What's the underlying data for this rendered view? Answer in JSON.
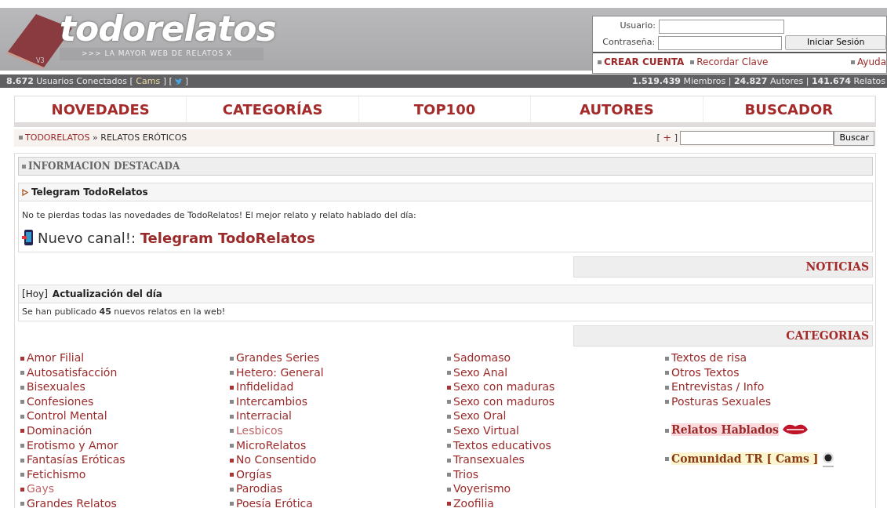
{
  "header": {
    "logo": "todorelatos",
    "version": "V3",
    "tagline": ">>> LA MAYOR WEB DE RELATOS X"
  },
  "login": {
    "user_label": "Usuario:",
    "password_label": "Contraseña:",
    "submit": "Iniciar Sesión",
    "links": [
      {
        "label": "CREAR CUENTA",
        "bold": true
      },
      {
        "label": "Recordar Clave",
        "bold": false
      },
      {
        "label": "Ayuda",
        "bold": false
      }
    ]
  },
  "status_bar": {
    "online_count": "8.672",
    "online_label": "Usuarios Conectados",
    "cams_before": "[",
    "cams": "Cams",
    "cams_after": "] [",
    "twitter_after": "]",
    "separator_1": "|",
    "separator_2": "|",
    "members": "1.519.439",
    "members_label": "Miembros",
    "authors": "24.827",
    "authors_label": "Autores",
    "stories": "141.674",
    "stories_label": "Relatos"
  },
  "nav": [
    "NOVEDADES",
    "CATEGORÍAS",
    "TOP100",
    "AUTORES",
    "BUSCADOR"
  ],
  "breadcrumb": {
    "home": "TODORELATOS",
    "separator": "»",
    "current": "RELATOS ERÓTICOS",
    "plus_open": "[",
    "plus": "+",
    "plus_close": "]",
    "search_button": "Buscar"
  },
  "featured": {
    "heading": "INFORMACION DESTACADA",
    "item_title": "Telegram TodoRelatos",
    "text": "No te pierdas todas las novedades de TodoRelatos! El mejor relato y relato hablado del día:",
    "channel_prefix": "Nuevo canal!:",
    "channel_link": "Telegram TodoRelatos"
  },
  "news": {
    "heading": "NOTICIAS",
    "tag": "[Hoy]",
    "title": "Actualización del día",
    "text": "Se han publicado **45** nuevos relatos en la web!"
  },
  "categories": {
    "heading": "CATEGORIAS",
    "columns": [
      [
        {
          "label": "Amor Filial",
          "marked": true,
          "dimmed": false
        },
        {
          "label": "Autosatisfacción",
          "marked": false,
          "dimmed": false
        },
        {
          "label": "Bisexuales",
          "marked": false,
          "dimmed": false
        },
        {
          "label": "Confesiones",
          "marked": false,
          "dimmed": false
        },
        {
          "label": "Control Mental",
          "marked": false,
          "dimmed": false
        },
        {
          "label": "Dominación",
          "marked": true,
          "dimmed": false
        },
        {
          "label": "Erotismo y Amor",
          "marked": false,
          "dimmed": false
        },
        {
          "label": "Fantasías Eróticas",
          "marked": false,
          "dimmed": false
        },
        {
          "label": "Fetichismo",
          "marked": false,
          "dimmed": false
        },
        {
          "label": "Gays",
          "marked": true,
          "dimmed": true
        },
        {
          "label": "Grandes Relatos",
          "marked": false,
          "dimmed": false
        }
      ],
      [
        {
          "label": "Grandes Series",
          "marked": false,
          "dimmed": false
        },
        {
          "label": "Hetero: General",
          "marked": false,
          "dimmed": false
        },
        {
          "label": "Infidelidad",
          "marked": true,
          "dimmed": false
        },
        {
          "label": "Intercambios",
          "marked": false,
          "dimmed": false
        },
        {
          "label": "Interracial",
          "marked": false,
          "dimmed": false
        },
        {
          "label": "Lesbicos",
          "marked": false,
          "dimmed": true
        },
        {
          "label": "MicroRelatos",
          "marked": false,
          "dimmed": false
        },
        {
          "label": "No Consentido",
          "marked": true,
          "dimmed": false
        },
        {
          "label": "Orgías",
          "marked": true,
          "dimmed": false
        },
        {
          "label": "Parodias",
          "marked": false,
          "dimmed": false
        },
        {
          "label": "Poesía Erótica",
          "marked": false,
          "dimmed": false
        }
      ],
      [
        {
          "label": "Sadomaso",
          "marked": false,
          "dimmed": false
        },
        {
          "label": "Sexo Anal",
          "marked": false,
          "dimmed": false
        },
        {
          "label": "Sexo con maduras",
          "marked": true,
          "dimmed": false
        },
        {
          "label": "Sexo con maduros",
          "marked": false,
          "dimmed": false
        },
        {
          "label": "Sexo Oral",
          "marked": false,
          "dimmed": false
        },
        {
          "label": "Sexo Virtual",
          "marked": false,
          "dimmed": false
        },
        {
          "label": "Textos educativos",
          "marked": false,
          "dimmed": false
        },
        {
          "label": "Transexuales",
          "marked": false,
          "dimmed": false
        },
        {
          "label": "Trios",
          "marked": false,
          "dimmed": false
        },
        {
          "label": "Voyerismo",
          "marked": false,
          "dimmed": false
        },
        {
          "label": "Zoofilia",
          "marked": true,
          "dimmed": false
        }
      ],
      [
        {
          "label": "Textos de risa",
          "marked": false,
          "dimmed": false
        },
        {
          "label": "Otros Textos",
          "marked": false,
          "dimmed": false
        },
        {
          "label": "Entrevistas / Info",
          "marked": false,
          "dimmed": false
        },
        {
          "label": "Posturas Sexuales",
          "marked": false,
          "dimmed": false
        },
        {
          "label": "Relatos Hablados",
          "kind": "audio",
          "marked": false
        },
        {
          "label": "Comunidad TR [ Cams ]",
          "kind": "cams",
          "marked": false
        }
      ]
    ]
  }
}
